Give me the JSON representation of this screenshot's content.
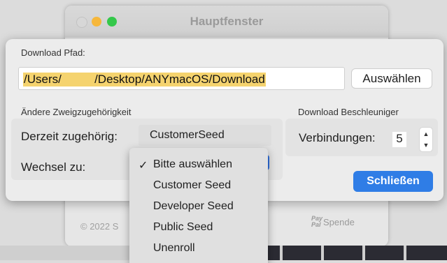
{
  "main_window": {
    "title": "Hauptfenster",
    "copyright": "© 2022 S",
    "spende_icon": "paypal-icon",
    "paypal_text": "Pay Pal",
    "spende_label": "Spende"
  },
  "sheet": {
    "download_path_label": "Download Pfad:",
    "download_path_value": "/Users/          /Desktop/ANYmacOS/Download",
    "choose_button": "Auswählen",
    "seed_group_label": "Ändere Zweigzugehörigkeit",
    "current_label": "Derzeit zugehörig:",
    "current_value": "CustomerSeed",
    "switch_label": "Wechsel zu:",
    "accelerator_label": "Download Beschleuniger",
    "connections_label": "Verbindungen:",
    "connections_value": "5",
    "close_button": "Schließen"
  },
  "dropdown": {
    "selected_check": "✓",
    "items": [
      "Bitte auswählen",
      "Customer Seed",
      "Developer Seed",
      "Public Seed",
      "Unenroll"
    ]
  },
  "colors": {
    "accent": "#2f7de6",
    "highlight": "#f5d36e",
    "traffic_minimize": "#f6b73b",
    "traffic_zoom": "#34c84a"
  }
}
